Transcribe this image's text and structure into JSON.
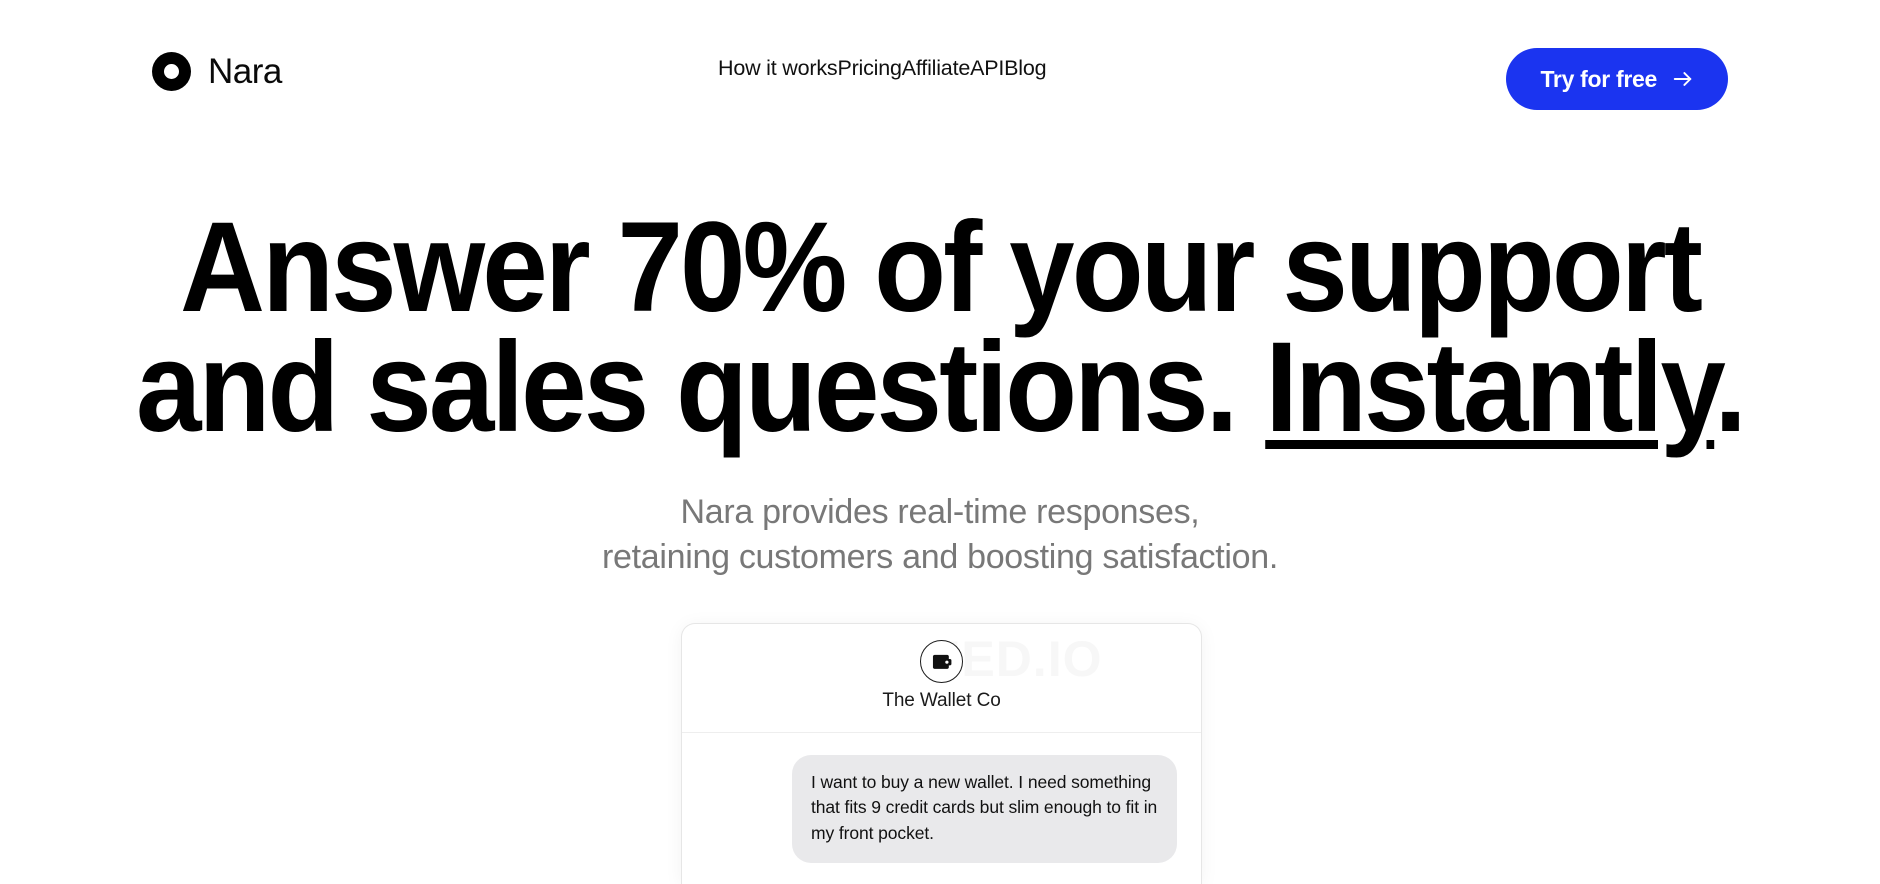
{
  "brand": {
    "name": "Nara",
    "logo_icon": "ring-logo-icon"
  },
  "nav": {
    "items": [
      {
        "label": "How it works"
      },
      {
        "label": "Pricing"
      },
      {
        "label": "Affiliate"
      },
      {
        "label": "API"
      },
      {
        "label": "Blog"
      }
    ]
  },
  "cta": {
    "label": "Try for free",
    "icon": "arrow-right-icon",
    "color": "#1b34f0",
    "text_color": "#ffffff"
  },
  "hero": {
    "headline_line1": "Answer 70% of your support",
    "headline_line2_pre": "and sales questions. ",
    "headline_line2_emphasis": "Instantly",
    "headline_line2_post": ".",
    "subhead_line1": "Nara provides real-time responses,",
    "subhead_line2": "retaining customers and boosting satisfaction.",
    "subhead_color": "#787878",
    "headline_color": "#000000"
  },
  "chat": {
    "watermark": "EED.IO",
    "avatar_icon": "wallet-icon",
    "brand_name": "The Wallet Co",
    "messages": [
      {
        "author": "user",
        "text": "I want to buy a new wallet. I need something that fits 9 credit cards but slim enough to fit in my front pocket.",
        "bubble_color": "#e9e9eb"
      }
    ]
  }
}
